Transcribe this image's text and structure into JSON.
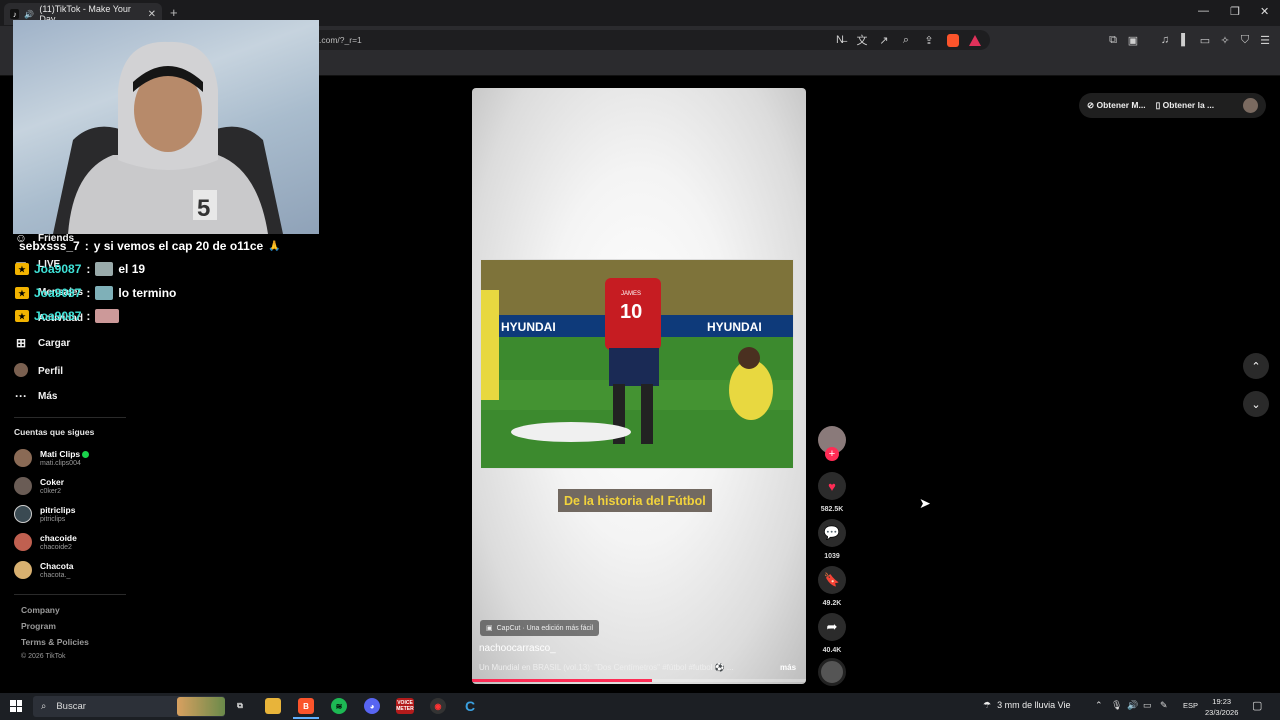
{
  "browser": {
    "tab_title": "(11)TikTok - Make Your Day",
    "url": ".com/?_r=1",
    "window_controls": [
      "minimize-icon",
      "restore-icon",
      "close-icon"
    ]
  },
  "chat": [
    {
      "user": "sebxsss_7",
      "sep": " : ",
      "text": "y si vemos el cap 20 de o11ce",
      "style": "white"
    },
    {
      "user": "Joa9087",
      "sep": " : ",
      "text": "el 19",
      "style": "cyan"
    },
    {
      "user": "Joa9087",
      "sep": " : ",
      "text": "lo termino",
      "style": "cyan"
    },
    {
      "user": "Joa9087",
      "sep": " : ",
      "text": "",
      "style": "cyan"
    }
  ],
  "sidebar": {
    "items": [
      {
        "label": "Friends"
      },
      {
        "label": "LIVE"
      },
      {
        "label": "Mensajes"
      },
      {
        "label": "Actividad"
      },
      {
        "label": "Cargar"
      },
      {
        "label": "Perfil"
      },
      {
        "label": "Más"
      }
    ],
    "following_title": "Cuentas que sigues",
    "following": [
      {
        "name": "Mati Clips",
        "handle": "mati.clips004",
        "color": "#8a6a55"
      },
      {
        "name": "Coker",
        "handle": "c0ker2",
        "color": "#6a5c55"
      },
      {
        "name": "pitriclips",
        "handle": "pitriclips",
        "color": "#3a4a52"
      },
      {
        "name": "chacoide",
        "handle": "chacoide2",
        "color": "#c06050"
      },
      {
        "name": "Chacota",
        "handle": "chacota._",
        "color": "#d8b070"
      }
    ],
    "footer": [
      "Company",
      "Program",
      "Terms & Policies",
      "© 2026 TikTok"
    ]
  },
  "video": {
    "caption": "De la historia del Fútbol",
    "capcut": "CapCut · Una edición más fácil",
    "author": "nachoocarrasco_",
    "description": "Un Mundial en BRASIL (vol.13): \"Dos Centímetros\" #fútbol #futbol ⚽ ...",
    "more": "más",
    "progress": 0.54,
    "jersey_name": "JAMES",
    "jersey_number": "10",
    "board_text": "HYUNDAI"
  },
  "actions": {
    "likes": "582.5K",
    "comments": "1039",
    "saves": "49.2K",
    "shares": "40.4K"
  },
  "top_right": {
    "get_app": "Obtener M...",
    "get_desktop": "Obtener la ..."
  },
  "taskbar": {
    "search_placeholder": "Buscar",
    "weather": "3 mm de lluvia Vie",
    "language": "ESP",
    "time": "19:23",
    "date": "23/3/2026",
    "voicemeeter": "VOICE METER"
  },
  "colors": {
    "tiktok_red": "#fe2c55",
    "chat_cyan": "#3fe3d8",
    "caption_yellow": "#f2d33c"
  }
}
